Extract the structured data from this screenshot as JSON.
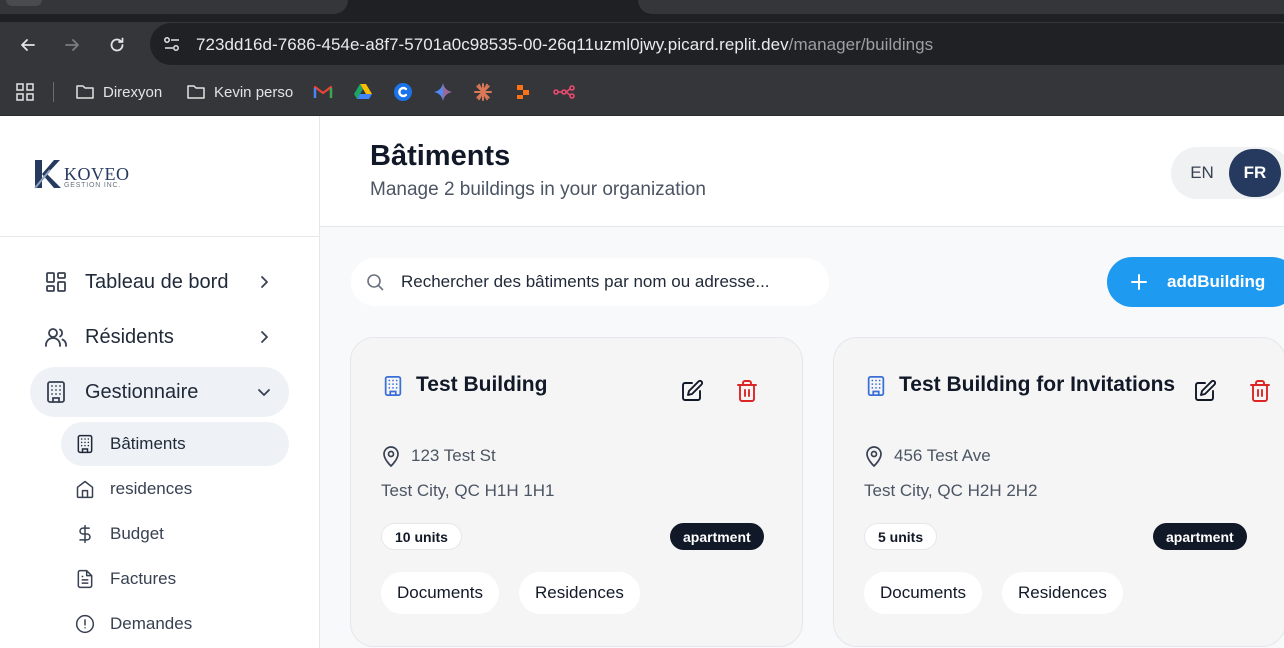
{
  "browser": {
    "url_host": "723dd16d-7686-454e-a8f7-5701a0c98535-00-26q11uzml0jwy.picard.replit.dev",
    "url_path": "/manager/buildings",
    "bookmarks": [
      {
        "label": "Direxyon",
        "icon": "folder-icon"
      },
      {
        "label": "Kevin perso",
        "icon": "folder-icon"
      }
    ]
  },
  "logo": {
    "word": "KOVEO",
    "sub": "GESTION INC."
  },
  "sidebar": {
    "items": [
      {
        "label": "Tableau de bord",
        "icon": "dashboard-icon"
      },
      {
        "label": "Résidents",
        "icon": "users-icon"
      },
      {
        "label": "Gestionnaire",
        "icon": "building-icon"
      }
    ],
    "subitems": [
      {
        "label": "Bâtiments",
        "icon": "building-icon"
      },
      {
        "label": "residences",
        "icon": "home-icon"
      },
      {
        "label": "Budget",
        "icon": "dollar-icon"
      },
      {
        "label": "Factures",
        "icon": "file-icon"
      },
      {
        "label": "Demandes",
        "icon": "alert-icon"
      }
    ]
  },
  "header": {
    "title": "Bâtiments",
    "subtitle": "Manage 2 buildings in your organization",
    "lang_en": "EN",
    "lang_fr": "FR",
    "lang_selected": "FR"
  },
  "search": {
    "placeholder": "Rechercher des bâtiments par nom ou adresse..."
  },
  "add_button": {
    "label": "addBuilding"
  },
  "buildings": [
    {
      "name": "Test Building",
      "address": "123 Test St",
      "city_line": "Test City, QC H1H 1H1",
      "units": "10 units",
      "type": "apartment",
      "documents_label": "Documents",
      "residences_label": "Residences"
    },
    {
      "name": "Test Building for Invitations",
      "address": "456 Test Ave",
      "city_line": "Test City, QC H2H 2H2",
      "units": "5 units",
      "type": "apartment",
      "documents_label": "Documents",
      "residences_label": "Residences"
    }
  ],
  "colors": {
    "primary": "#1e9bf0",
    "navy": "#253a5e",
    "delete": "#dc2626",
    "building_icon": "#3b6fd8"
  }
}
